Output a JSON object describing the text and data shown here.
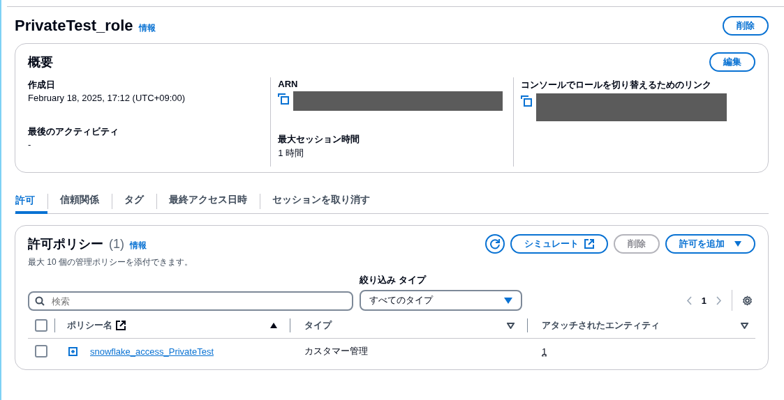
{
  "page": {
    "title": "PrivateTest_role",
    "info_link": "情報",
    "delete_button": {
      "label": "削除",
      "disabled": false
    }
  },
  "summary": {
    "title": "概要",
    "edit_button": {
      "label": "編集",
      "disabled": false
    },
    "columns": [
      [
        {
          "label": "作成日",
          "value": "February 18, 2025, 17:12 (UTC+09:00)",
          "kind": "text"
        },
        {
          "label": "最後のアクティビティ",
          "value": "-",
          "kind": "text"
        }
      ],
      [
        {
          "label": "ARN",
          "kind": "redacted-copy"
        },
        {
          "label": "最大セッション時間",
          "value": "1 時間",
          "kind": "text"
        }
      ],
      [
        {
          "label": "コンソールでロールを切り替えるためのリンク",
          "kind": "redacted-copy"
        }
      ]
    ]
  },
  "tabs": [
    {
      "label": "許可",
      "selected": true
    },
    {
      "label": "信頼関係",
      "selected": false
    },
    {
      "label": "タグ",
      "selected": false
    },
    {
      "label": "最終アクセス日時",
      "selected": false
    },
    {
      "label": "セッションを取り消す",
      "selected": false
    }
  ],
  "policies": {
    "title": "許可ポリシー",
    "count": "(1)",
    "info_link": "情報",
    "description": "最大 10 個の管理ポリシーを添付できます。",
    "buttons": [
      {
        "kind": "refresh",
        "disabled": false
      },
      {
        "kind": "external",
        "label": "シミュレート",
        "disabled": false
      },
      {
        "kind": "plain",
        "label": "削除",
        "disabled": true
      },
      {
        "kind": "dropdown",
        "label": "許可を追加",
        "disabled": false
      }
    ],
    "search": {
      "placeholder": "検索"
    },
    "filter": {
      "label": "絞り込み タイプ",
      "value": "すべてのタイプ"
    },
    "pagination": {
      "page": "1",
      "prev_disabled": true,
      "next_disabled": true
    },
    "table": {
      "select_all_checked": false,
      "columns": [
        {
          "label": "ポリシー名",
          "external": true,
          "sorted": true
        },
        {
          "label": "タイプ",
          "external": false,
          "sorted": false
        },
        {
          "label": "アタッチされたエンティティ",
          "external": false,
          "sorted": false
        }
      ],
      "rows": [
        {
          "checked": false,
          "expanded": false,
          "name": "snowflake_access_PrivateTest",
          "type": "カスタマー管理",
          "entities": "1"
        }
      ]
    }
  }
}
